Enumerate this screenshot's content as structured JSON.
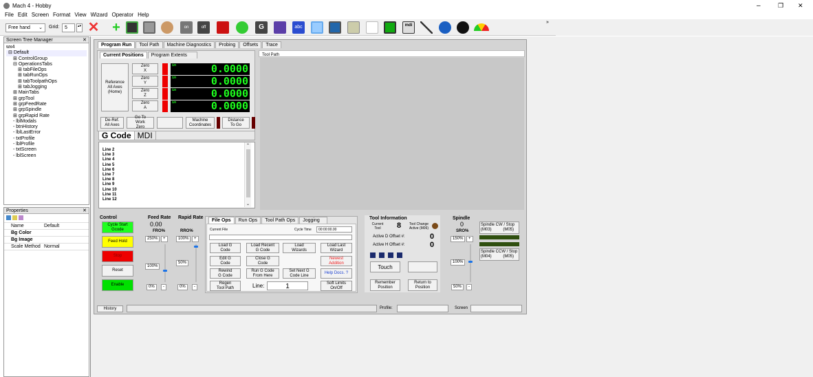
{
  "window": {
    "title": "Mach 4 - Hobby",
    "controls": [
      "–",
      "❐",
      "✕"
    ]
  },
  "menu": [
    "File",
    "Edit",
    "Screen",
    "Format",
    "View",
    "Wizard",
    "Operator",
    "Help"
  ],
  "toolbar": {
    "mode_value": "Free hand",
    "grid_label": "Grid:",
    "grid_value": "5",
    "overflow": "»"
  },
  "toolbar_icons": [
    "delete-icon",
    "add-icon",
    "panel-icon",
    "button-icon",
    "image-icon",
    "toggle-on-icon",
    "toggle-off-icon",
    "dro-icon",
    "led-icon",
    "gcode-icon",
    "grid-icon",
    "label-icon",
    "textbox-icon",
    "slider-icon",
    "folder-icon",
    "bookmark-icon",
    "save-icon",
    "mdi-icon",
    "line-icon",
    "tool-icon",
    "spindle-icon",
    "gauge-icon"
  ],
  "screen_tree": {
    "title": "Screen Tree Manager",
    "root": "wx4",
    "items": [
      "Default",
      "ControlGroup",
      "OperationsTabs",
      "tabFileOps",
      "tabRunOps",
      "tabToolpathOps",
      "tabJogging",
      "MainTabs",
      "grpTool",
      "grpFeedRate",
      "grpSpindle",
      "grpRapid Rate",
      "lblModals",
      "btnHistory",
      "lblLastError",
      "txtProfile",
      "lblProfile",
      "txtScreen",
      "lblScreen"
    ]
  },
  "properties": {
    "title": "Properties",
    "rows": [
      {
        "k": "Name",
        "v": "Default"
      },
      {
        "k": "Bg Color",
        "v": ""
      },
      {
        "k": "Bg Image",
        "v": ""
      },
      {
        "k": "Scale Method",
        "v": "Normal"
      }
    ]
  },
  "main_tabs": [
    "Program Run",
    "Tool Path",
    "Machine Diagnostics",
    "Probing",
    "Offsets",
    "Trace"
  ],
  "position_tabs": [
    "Current Positions",
    "Program Extents"
  ],
  "ref_all": "Reference All Axes (Home)",
  "axes": [
    {
      "zero": "Zero X",
      "value": "0.0000"
    },
    {
      "zero": "Zero Y",
      "value": "0.0000"
    },
    {
      "zero": "Zero Z",
      "value": "0.0000"
    },
    {
      "zero": "Zero A",
      "value": "0.0000"
    }
  ],
  "dro_unit": "in",
  "pos_buttons": {
    "deref": "De-Ref. All Axes",
    "goto": "Go To Work Zero",
    "machine": "Machine Coordinates",
    "dist": "Distance To Go"
  },
  "gcode_tabs": [
    "G Code",
    "MDI"
  ],
  "gcode_lines": [
    "Line 2",
    "Line 3",
    "Line 4",
    "Line 5",
    "Line 6",
    "Line 7",
    "Line 8",
    "Line 9",
    "Line 10",
    "Line 11",
    "Line 12"
  ],
  "toolpath_label": "Tool Path",
  "control": {
    "title": "Control",
    "cycle_start": "Cycle Start Gcode",
    "feed_hold": "Feed Hold",
    "stop": "Stop",
    "reset": "Reset",
    "enable": "Enable"
  },
  "feed": {
    "title": "Feed Rate",
    "value": "0.00",
    "label": "FRO%",
    "pct": "250%",
    "slider": "100%",
    "bottom": "0%"
  },
  "rapid": {
    "title": "Rapid Rate",
    "label": "RRO%",
    "pct": "100%",
    "slider": "50%",
    "bottom": "0%"
  },
  "ops_tabs": [
    "File Ops",
    "Run Ops",
    "Tool Path Ops",
    "Jogging"
  ],
  "file_ops": {
    "current_file": "Current File",
    "cycle_time_label": "Cycle Time",
    "cycle_time": "00:00:00.00",
    "load": "Load G Code",
    "load_recent": "Load Recent G Code",
    "load_wizards": "Load Wizards",
    "load_last": "Load Last Wizard",
    "edit": "Edit G Code",
    "close": "Close G Code",
    "newest": "Newest Addition",
    "rewind": "Rewind G Code",
    "run_from": "Run G Code From Here",
    "set_next": "Set Next G Code Line",
    "help": "Help Docs. ?",
    "regen": "Regen Tool Path",
    "line_label": "Line:",
    "line_value": "1",
    "soft_limits": "Soft Limits On/Off"
  },
  "tool_info": {
    "title": "Tool Information",
    "current_tool_label": "Current Tool",
    "current_tool": "8",
    "tool_change": "Tool Change Active (M06)",
    "d_offset_label": "Active D Offset #:",
    "d_offset": "0",
    "h_offset_label": "Active H Offset #:",
    "h_offset": "0",
    "touch": "Touch",
    "remember": "Remember Position",
    "return": "Return to Position"
  },
  "spindle": {
    "title": "Spindle",
    "value": "0",
    "label": "SRO%",
    "pct": "150%",
    "slider": "100%",
    "bottom": "50%",
    "cw": "Spindle CW / Stop",
    "cw_codes": "(M03)          (M05)",
    "ccw": "Spindle CCW / Stop",
    "ccw_codes": "(M04)          (M05)"
  },
  "status": {
    "history": "History",
    "profile": "Profile:",
    "screen": "Screen"
  },
  "colors": {
    "green_led": "#1eff1e",
    "red": "#e00000",
    "yellow": "#ffff00",
    "enable": "#00e000"
  }
}
